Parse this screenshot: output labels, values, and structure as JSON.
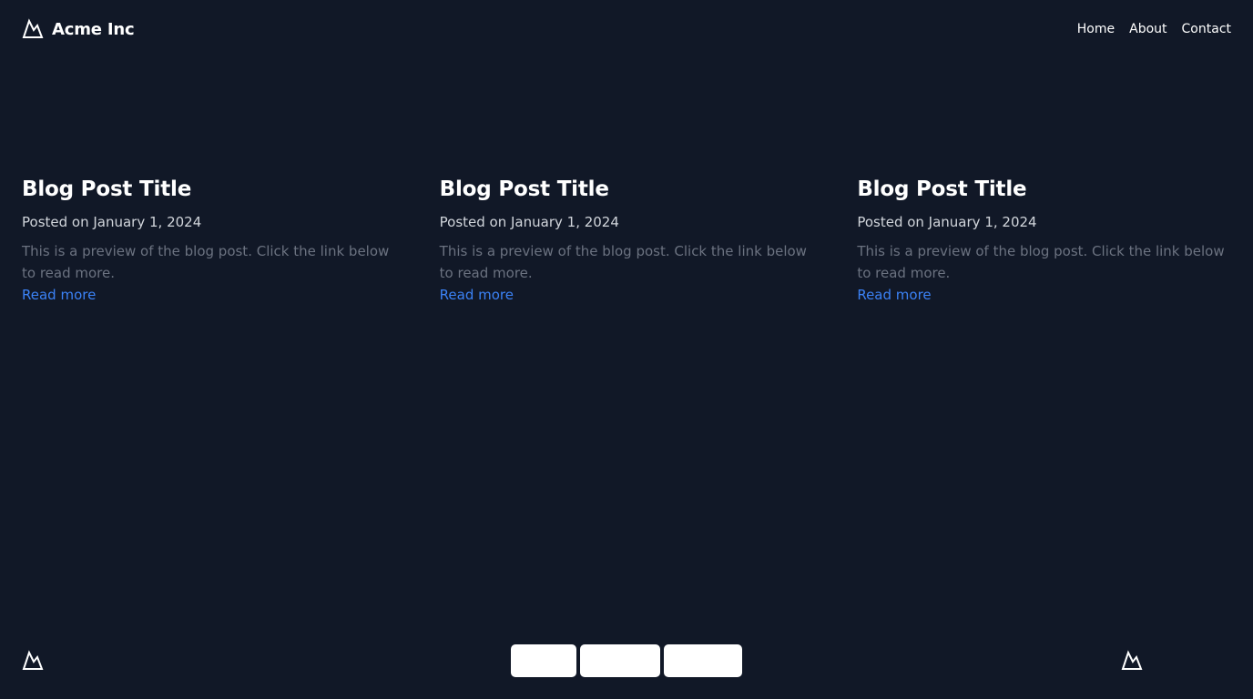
{
  "header": {
    "brand_name": "Acme Inc",
    "logo_icon": "mountain-icon",
    "nav": [
      {
        "label": "Home"
      },
      {
        "label": "About"
      },
      {
        "label": "Contact"
      }
    ]
  },
  "posts": [
    {
      "title": "Blog Post Title",
      "date": "Posted on January 1, 2024",
      "preview": "This is a preview of the blog post. Click the link below to read more.",
      "link_label": "Read more"
    },
    {
      "title": "Blog Post Title",
      "date": "Posted on January 1, 2024",
      "preview": "This is a preview of the blog post. Click the link below to read more.",
      "link_label": "Read more"
    },
    {
      "title": "Blog Post Title",
      "date": "Posted on January 1, 2024",
      "preview": "This is a preview of the blog post. Click the link below to read more.",
      "link_label": "Read more"
    }
  ],
  "footer": {
    "logo_icon": "mountain-icon",
    "buttons": [
      {
        "label": ""
      },
      {
        "label": ""
      },
      {
        "label": ""
      }
    ]
  },
  "colors": {
    "background": "#111827",
    "title": "#ffffff",
    "date": "#d1d5db",
    "preview": "#6b7280",
    "link": "#3b82f6",
    "footer_button": "#ffffff"
  }
}
